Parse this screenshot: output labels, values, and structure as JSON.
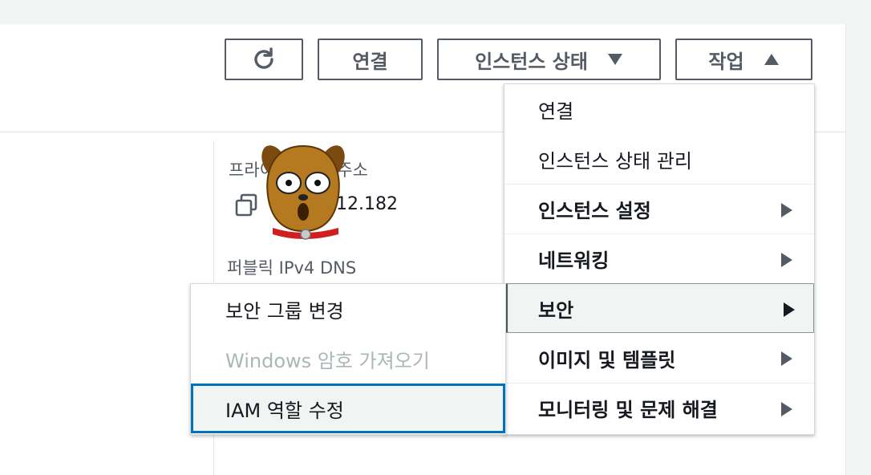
{
  "toolbar": {
    "refresh_icon": "refresh-icon",
    "connect_label": "연결",
    "instance_state_label": "인스턴스 상태",
    "actions_label": "작업"
  },
  "details": {
    "private_ipv4_label": "프라이빗 IPv4 주소",
    "private_ipv4_value": "...12.182",
    "public_ipv4_dns_label": "퍼블릭 IPv4 DNS"
  },
  "actions_menu": {
    "items": [
      {
        "label": "연결",
        "submenu": false
      },
      {
        "label": "인스턴스 상태 관리",
        "submenu": false
      },
      {
        "label": "인스턴스 설정",
        "submenu": true
      },
      {
        "label": "네트워킹",
        "submenu": true
      },
      {
        "label": "보안",
        "submenu": true,
        "active": true
      },
      {
        "label": "이미지 및 템플릿",
        "submenu": true
      },
      {
        "label": "모니터링 및 문제 해결",
        "submenu": true
      }
    ]
  },
  "security_submenu": {
    "items": [
      {
        "label": "보안 그룹 변경",
        "disabled": false
      },
      {
        "label": "Windows 암호 가져오기",
        "disabled": true
      },
      {
        "label": "IAM 역할 수정",
        "focused": true
      }
    ]
  },
  "colors": {
    "button_border": "#545b64",
    "focus_ring": "#0073bb",
    "disabled_text": "#aab7b8",
    "mascot_fur": "#b5791f",
    "collar": "#d01f1f"
  }
}
